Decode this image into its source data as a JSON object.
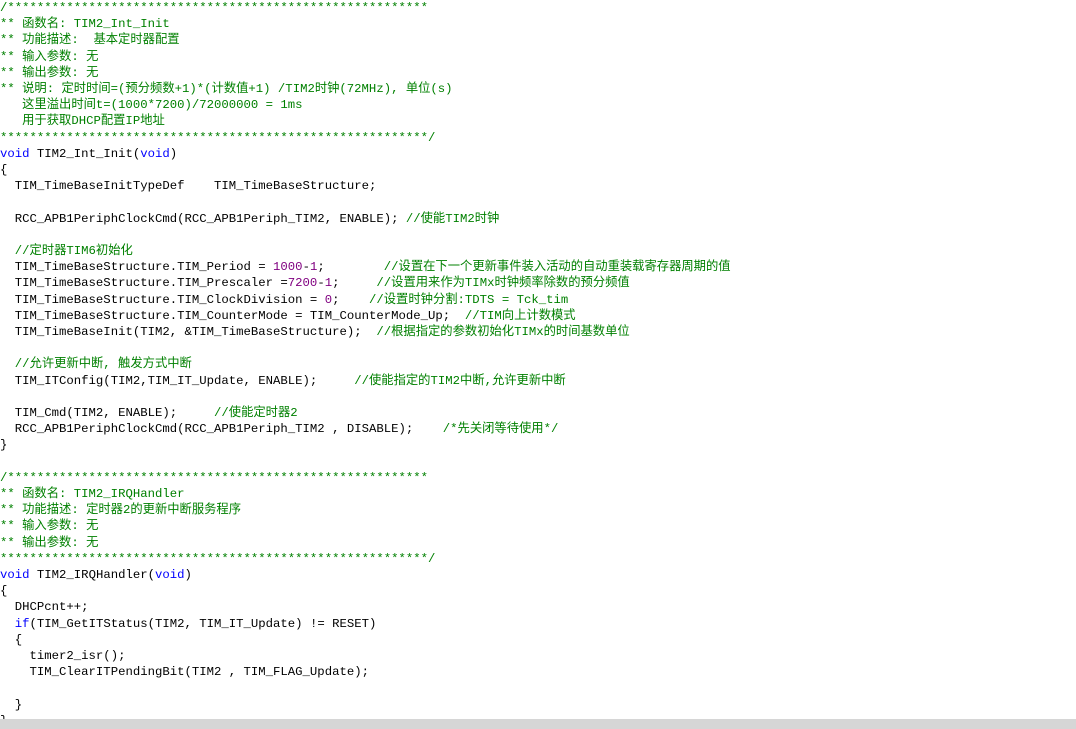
{
  "code": {
    "lines": [
      [
        {
          "t": "/*********************************************************",
          "c": "cm"
        }
      ],
      [
        {
          "t": "** 函数名: TIM2_Int_Init",
          "c": "cm"
        }
      ],
      [
        {
          "t": "** 功能描述:  基本定时器配置",
          "c": "cm"
        }
      ],
      [
        {
          "t": "** 输入参数: 无",
          "c": "cm"
        }
      ],
      [
        {
          "t": "** 输出参数: 无",
          "c": "cm"
        }
      ],
      [
        {
          "t": "** 说明: 定时时间=(预分频数+1)*(计数值+1) /TIM2时钟(72MHz), 单位(s)",
          "c": "cm"
        }
      ],
      [
        {
          "t": "   这里溢出时间t=(1000*7200)/72000000 = 1ms",
          "c": "cm"
        }
      ],
      [
        {
          "t": "   用于获取DHCP配置IP地址",
          "c": "cm"
        }
      ],
      [
        {
          "t": "**********************************************************/",
          "c": "cm"
        }
      ],
      [
        {
          "t": "void",
          "c": "kw"
        },
        {
          "t": " TIM2_Int_Init(",
          "c": "tx"
        },
        {
          "t": "void",
          "c": "kw"
        },
        {
          "t": ")",
          "c": "tx"
        }
      ],
      [
        {
          "t": "{",
          "c": "tx"
        }
      ],
      [
        {
          "t": "  TIM_TimeBaseInitTypeDef    TIM_TimeBaseStructure;",
          "c": "tx"
        }
      ],
      [
        {
          "t": "",
          "c": "tx"
        }
      ],
      [
        {
          "t": "  RCC_APB1PeriphClockCmd(RCC_APB1Periph_TIM2, ENABLE); ",
          "c": "tx"
        },
        {
          "t": "//使能TIM2时钟",
          "c": "cm"
        }
      ],
      [
        {
          "t": "",
          "c": "tx"
        }
      ],
      [
        {
          "t": "  //定时器TIM6初始化",
          "c": "cm"
        }
      ],
      [
        {
          "t": "  TIM_TimeBaseStructure.TIM_Period = ",
          "c": "tx"
        },
        {
          "t": "1000",
          "c": "nm"
        },
        {
          "t": "-",
          "c": "tx"
        },
        {
          "t": "1",
          "c": "nm"
        },
        {
          "t": ";        ",
          "c": "tx"
        },
        {
          "t": "//设置在下一个更新事件装入活动的自动重装载寄存器周期的值",
          "c": "cm"
        }
      ],
      [
        {
          "t": "  TIM_TimeBaseStructure.TIM_Prescaler =",
          "c": "tx"
        },
        {
          "t": "7200",
          "c": "nm"
        },
        {
          "t": "-",
          "c": "tx"
        },
        {
          "t": "1",
          "c": "nm"
        },
        {
          "t": ";     ",
          "c": "tx"
        },
        {
          "t": "//设置用来作为TIMx时钟频率除数的预分频值",
          "c": "cm"
        }
      ],
      [
        {
          "t": "  TIM_TimeBaseStructure.TIM_ClockDivision = ",
          "c": "tx"
        },
        {
          "t": "0",
          "c": "nm"
        },
        {
          "t": ";    ",
          "c": "tx"
        },
        {
          "t": "//设置时钟分割:TDTS = Tck_tim",
          "c": "cm"
        }
      ],
      [
        {
          "t": "  TIM_TimeBaseStructure.TIM_CounterMode = TIM_CounterMode_Up;  ",
          "c": "tx"
        },
        {
          "t": "//TIM向上计数模式",
          "c": "cm"
        }
      ],
      [
        {
          "t": "  TIM_TimeBaseInit(TIM2, &TIM_TimeBaseStructure);  ",
          "c": "tx"
        },
        {
          "t": "//根据指定的参数初始化TIMx的时间基数单位",
          "c": "cm"
        }
      ],
      [
        {
          "t": "",
          "c": "tx"
        }
      ],
      [
        {
          "t": "  //允许更新中断, 触发方式中断",
          "c": "cm"
        }
      ],
      [
        {
          "t": "  TIM_ITConfig(TIM2,TIM_IT_Update, ENABLE);     ",
          "c": "tx"
        },
        {
          "t": "//使能指定的TIM2中断,允许更新中断",
          "c": "cm"
        }
      ],
      [
        {
          "t": "",
          "c": "tx"
        }
      ],
      [
        {
          "t": "  TIM_Cmd(TIM2, ENABLE);     ",
          "c": "tx"
        },
        {
          "t": "//使能定时器2",
          "c": "cm"
        }
      ],
      [
        {
          "t": "  RCC_APB1PeriphClockCmd(RCC_APB1Periph_TIM2 , DISABLE);    ",
          "c": "tx"
        },
        {
          "t": "/*先关闭等待使用*/",
          "c": "cm"
        }
      ],
      [
        {
          "t": "}",
          "c": "tx"
        }
      ],
      [
        {
          "t": "",
          "c": "tx"
        }
      ],
      [
        {
          "t": "/*********************************************************",
          "c": "cm"
        }
      ],
      [
        {
          "t": "** 函数名: TIM2_IRQHandler",
          "c": "cm"
        }
      ],
      [
        {
          "t": "** 功能描述: 定时器2的更新中断服务程序",
          "c": "cm"
        }
      ],
      [
        {
          "t": "** 输入参数: 无",
          "c": "cm"
        }
      ],
      [
        {
          "t": "** 输出参数: 无",
          "c": "cm"
        }
      ],
      [
        {
          "t": "**********************************************************/",
          "c": "cm"
        }
      ],
      [
        {
          "t": "void",
          "c": "kw"
        },
        {
          "t": " TIM2_IRQHandler(",
          "c": "tx"
        },
        {
          "t": "void",
          "c": "kw"
        },
        {
          "t": ")",
          "c": "tx"
        }
      ],
      [
        {
          "t": "{",
          "c": "tx"
        }
      ],
      [
        {
          "t": "  DHCPcnt++;",
          "c": "tx"
        }
      ],
      [
        {
          "t": "  ",
          "c": "tx"
        },
        {
          "t": "if",
          "c": "kw"
        },
        {
          "t": "(TIM_GetITStatus(TIM2, TIM_IT_Update) != RESET)",
          "c": "tx"
        }
      ],
      [
        {
          "t": "  {",
          "c": "tx"
        }
      ],
      [
        {
          "t": "    timer2_isr();",
          "c": "tx"
        }
      ],
      [
        {
          "t": "    TIM_ClearITPendingBit(TIM2 , TIM_FLAG_Update);",
          "c": "tx"
        }
      ],
      [
        {
          "t": "",
          "c": "tx"
        }
      ],
      [
        {
          "t": "  }",
          "c": "tx"
        }
      ],
      [
        {
          "t": "}",
          "c": "tx"
        }
      ]
    ]
  },
  "colors": {
    "background": "#ffffff",
    "comment": "#008000",
    "keyword": "#0000ff",
    "number": "#800080",
    "text": "#000000",
    "scrollbar": "#d6d6d6"
  }
}
